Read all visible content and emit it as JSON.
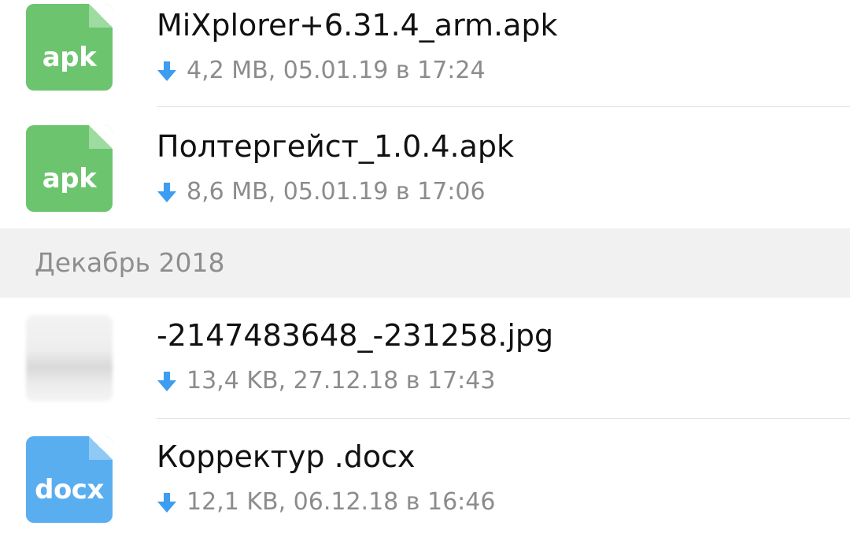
{
  "files_before": [
    {
      "name": "MiXplorer+6.31.4_arm.apk",
      "meta": "4,2 MB, 05.01.19 в 17:24",
      "icon": "apk-file-icon",
      "ext_label": "apk",
      "color": "#6cc46f",
      "fold_color": "#9edba0"
    },
    {
      "name": "Полтергейст_1.0.4.apk",
      "meta": "8,6 MB, 05.01.19 в 17:06",
      "icon": "apk-file-icon",
      "ext_label": "apk",
      "color": "#6cc46f",
      "fold_color": "#9edba0"
    }
  ],
  "section_header": "Декабрь 2018",
  "files_after": [
    {
      "name": "-2147483648_-231258.jpg",
      "meta": "13,4 KB, 27.12.18 в 17:43",
      "icon": "image-thumbnail"
    },
    {
      "name": "Корректур .docx",
      "meta": "12,1 KB, 06.12.18 в 16:46",
      "icon": "docx-file-icon",
      "ext_label": "docx",
      "color": "#59aef0",
      "fold_color": "#8fcaf6"
    }
  ],
  "download_icon": "download-arrow-icon",
  "download_color": "#3d9df0"
}
